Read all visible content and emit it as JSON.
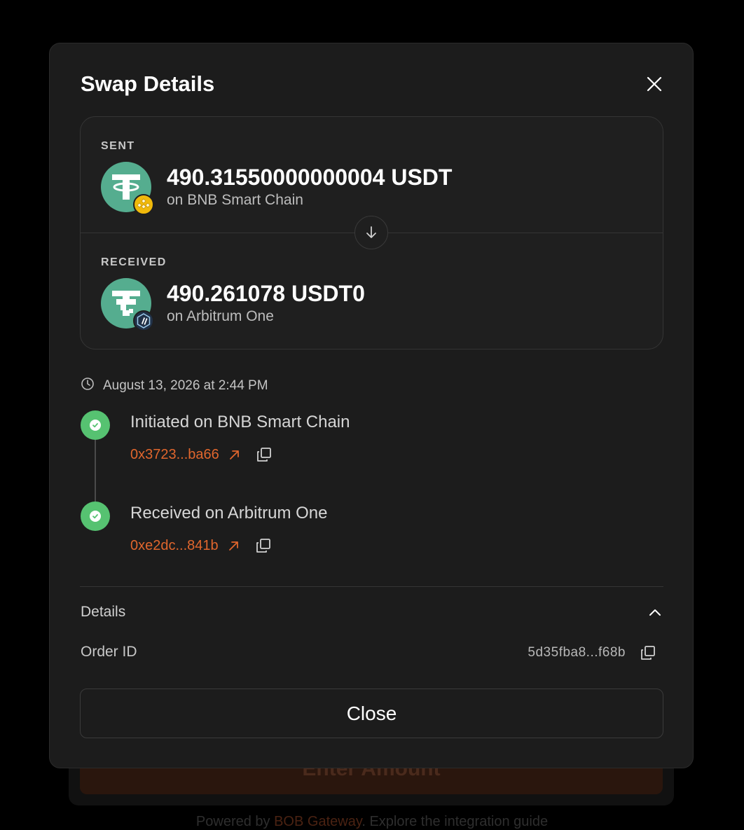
{
  "background": {
    "button_label": "Enter Amount",
    "footer_prefix": "Powered by ",
    "footer_link": "BOB Gateway",
    "footer_suffix": ". Explore the integration guide"
  },
  "modal": {
    "title": "Swap Details",
    "sent": {
      "label": "SENT",
      "amount": "490.31550000000004 USDT",
      "chain": "on BNB Smart Chain",
      "token_icon": "usdt-icon",
      "chain_icon": "bnb-icon"
    },
    "received": {
      "label": "RECEIVED",
      "amount": "490.261078 USDT0",
      "chain": "on Arbitrum One",
      "token_icon": "usdt0-icon",
      "chain_icon": "arbitrum-icon"
    },
    "date": "August 13, 2026 at 2:44 PM",
    "steps": [
      {
        "title": "Initiated on BNB Smart Chain",
        "hash": "0x3723...ba66"
      },
      {
        "title": "Received on Arbitrum One",
        "hash": "0xe2dc...841b"
      }
    ],
    "details": {
      "label": "Details",
      "order_id_label": "Order ID",
      "order_id_value": "5d35fba8...f68b"
    },
    "close_label": "Close"
  },
  "colors": {
    "accent_orange": "#e0662d",
    "success_green": "#56c271",
    "tether_green": "#55ad8f",
    "bnb_yellow": "#f0b90b",
    "arbitrum_navy": "#213147"
  }
}
